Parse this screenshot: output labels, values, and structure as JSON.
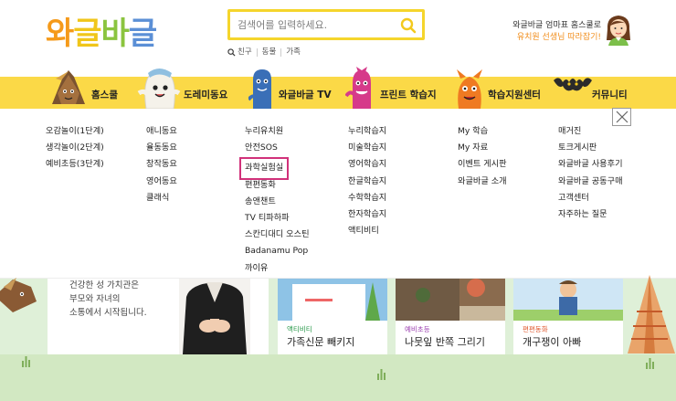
{
  "header": {
    "logo_chars": [
      {
        "ch": "와",
        "color": "#f59a1a"
      },
      {
        "ch": "글",
        "color": "#f0c61a"
      },
      {
        "ch": "바",
        "color": "#8bc43f"
      },
      {
        "ch": "글",
        "color": "#5b8fd6"
      }
    ],
    "search_placeholder": "검색어를 입력하세요.",
    "search_tags": [
      "친구",
      "동물",
      "가족"
    ],
    "promo_line1": "와글바글 엄마표 홈스쿨로",
    "promo_line2": "유치원 선생님 따라잡기!"
  },
  "nav": {
    "items": [
      {
        "label": "홈스쿨"
      },
      {
        "label": "도레미동요"
      },
      {
        "label": "와글바글 TV"
      },
      {
        "label": "프린트 학습지"
      },
      {
        "label": "학습지원센터"
      },
      {
        "label": "커뮤니티"
      }
    ]
  },
  "dropdown": {
    "columns": [
      [
        "오감놀이(1단계)",
        "생각놀이(2단계)",
        "예비초등(3단계)"
      ],
      [
        "애니동요",
        "율동동요",
        "창작동요",
        "영어동요",
        "클래식"
      ],
      [
        "누리유치원",
        "안전SOS",
        "과학실험실",
        "편편동화",
        "송앤챈트",
        "TV 티파하파",
        "스칸디대디 오스틴",
        "Badanamu Pop",
        "까이유"
      ],
      [
        "누리학습지",
        "미술학습지",
        "영어학습지",
        "한글학습지",
        "수학학습지",
        "한자학습지",
        "액티비티"
      ],
      [
        "My 학습",
        "My 자료",
        "이벤트 게시판",
        "와글바글 소개"
      ],
      [
        "매거진",
        "토크게시판",
        "와글바글 사용후기",
        "와글바글 공동구매",
        "고객센터",
        "자주하는 질문"
      ]
    ],
    "highlighted": "과학실험실"
  },
  "banner": {
    "text_lines": [
      "건강한 성 가치관은",
      "부모와 자녀의",
      "소통에서 시작됩니다."
    ]
  },
  "cards": [
    {
      "category": "액티비티",
      "category_color": "#2a9a4b",
      "title": "가족신문 빼키지"
    },
    {
      "category": "예비초등",
      "category_color": "#9b3fb0",
      "title": "나뭇잎 반쪽 그리기"
    },
    {
      "category": "편편동화",
      "category_color": "#e0552a",
      "title": "개구쟁이 아빠"
    }
  ]
}
